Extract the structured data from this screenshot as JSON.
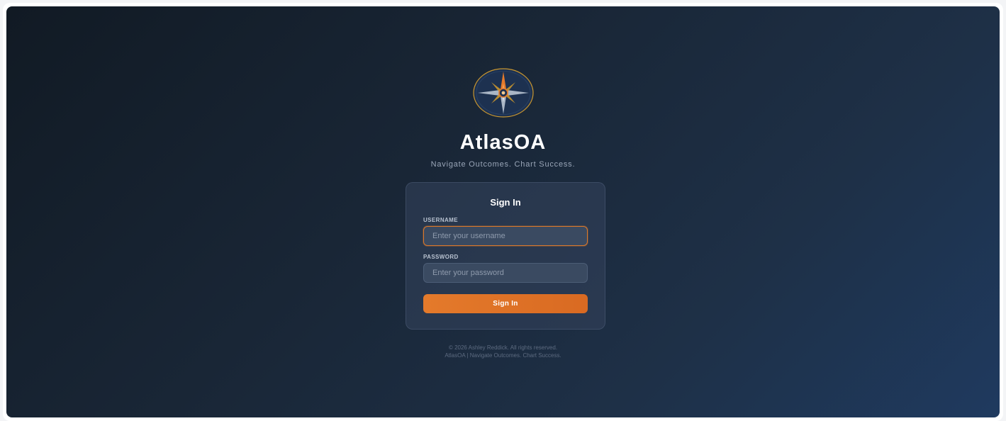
{
  "app": {
    "title": "AtlasOA",
    "tagline": "Navigate Outcomes. Chart Success."
  },
  "signin": {
    "heading": "Sign In",
    "username": {
      "label": "USERNAME",
      "placeholder": "Enter your username",
      "value": ""
    },
    "password": {
      "label": "PASSWORD",
      "placeholder": "Enter your password",
      "value": ""
    },
    "submit_label": "Sign In"
  },
  "footer": {
    "copyright": "© 2026 Ashley Reddick. All rights reserved.",
    "tagline": "AtlasOA | Navigate Outcomes. Chart Success."
  },
  "logo": {
    "icon": "compass-rose-icon"
  },
  "colors": {
    "accent": "#E47A2B",
    "background_start": "#111A24",
    "background_end": "#1F3A5F",
    "card": "#34445C",
    "field": "#3A4A61",
    "logo_ring": "#C9962E"
  }
}
